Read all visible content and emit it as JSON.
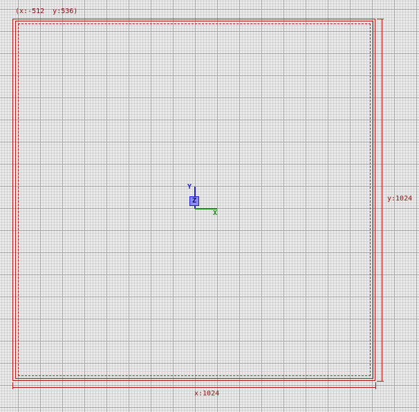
{
  "viewport": {
    "cursor_readout": "(x:-512  y:536)",
    "dimension_x_label": "x:1024",
    "dimension_y_label": "y:1024"
  },
  "gizmo": {
    "y_label": "Y",
    "x_label": "X",
    "z_label": "Z"
  },
  "colors": {
    "background": "#ececec",
    "grid_major": "#a6a6a6",
    "grid_minor": "#d2d2d2",
    "bounds": "#b01818",
    "axis_x": "#1a8a1a",
    "axis_y": "#1a1ad0",
    "origin_fill": "#8c8cf0"
  }
}
